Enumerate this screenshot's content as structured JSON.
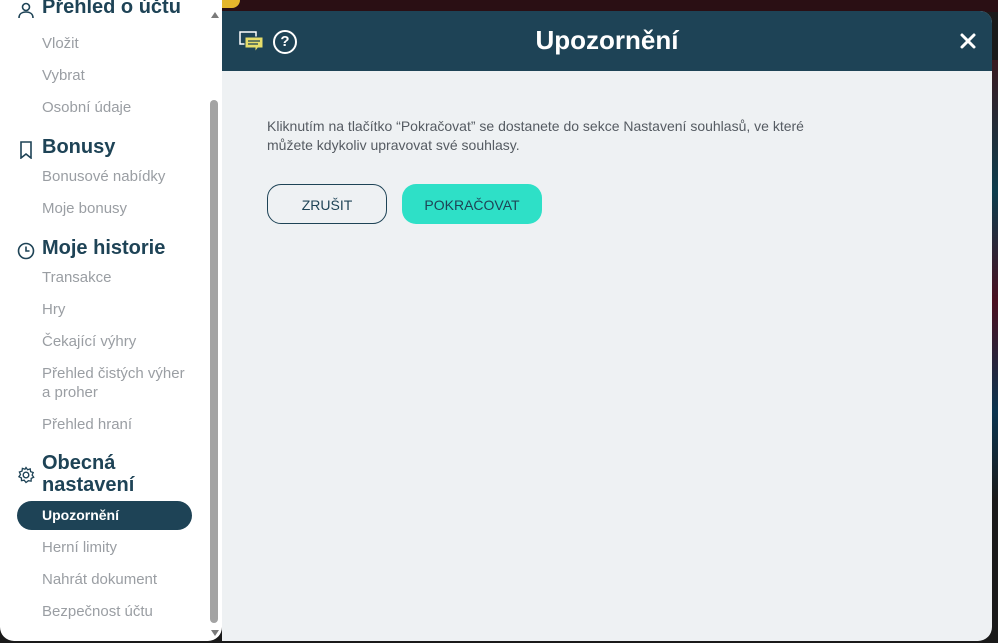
{
  "sidebar": {
    "sections": [
      {
        "title": "Přehled o účtu",
        "icon": "user-icon",
        "items": [
          "Vložit",
          "Vybrat",
          "Osobní údaje"
        ]
      },
      {
        "title": "Bonusy",
        "icon": "bookmark-icon",
        "items": [
          "Bonusové nabídky",
          "Moje bonusy"
        ]
      },
      {
        "title": "Moje historie",
        "icon": "clock-icon",
        "items": [
          "Transakce",
          "Hry",
          "Čekající výhry",
          "Přehled čistých výher a proher",
          "Přehled hraní"
        ]
      },
      {
        "title": "Obecná nastavení",
        "icon": "gear-icon",
        "items": [
          "Upozornění",
          "Herní limity",
          "Nahrát dokument",
          "Bezpečnost účtu"
        ]
      }
    ],
    "active_item": "Upozornění"
  },
  "modal": {
    "title": "Upozornění",
    "message": "Kliknutím na tlačítko “Pokračovat” se dostanete do sekce Nastavení souhlasů, ve které můžete kdykoliv upravovat své souhlasy.",
    "cancel_label": "ZRUŠIT",
    "continue_label": "POKRAČOVAT",
    "help_glyph": "?"
  },
  "colors": {
    "brand_dark": "#1e4356",
    "accent": "#2ee0c7",
    "panel_bg": "#eef1f3",
    "muted_text": "#9a9ea3"
  }
}
